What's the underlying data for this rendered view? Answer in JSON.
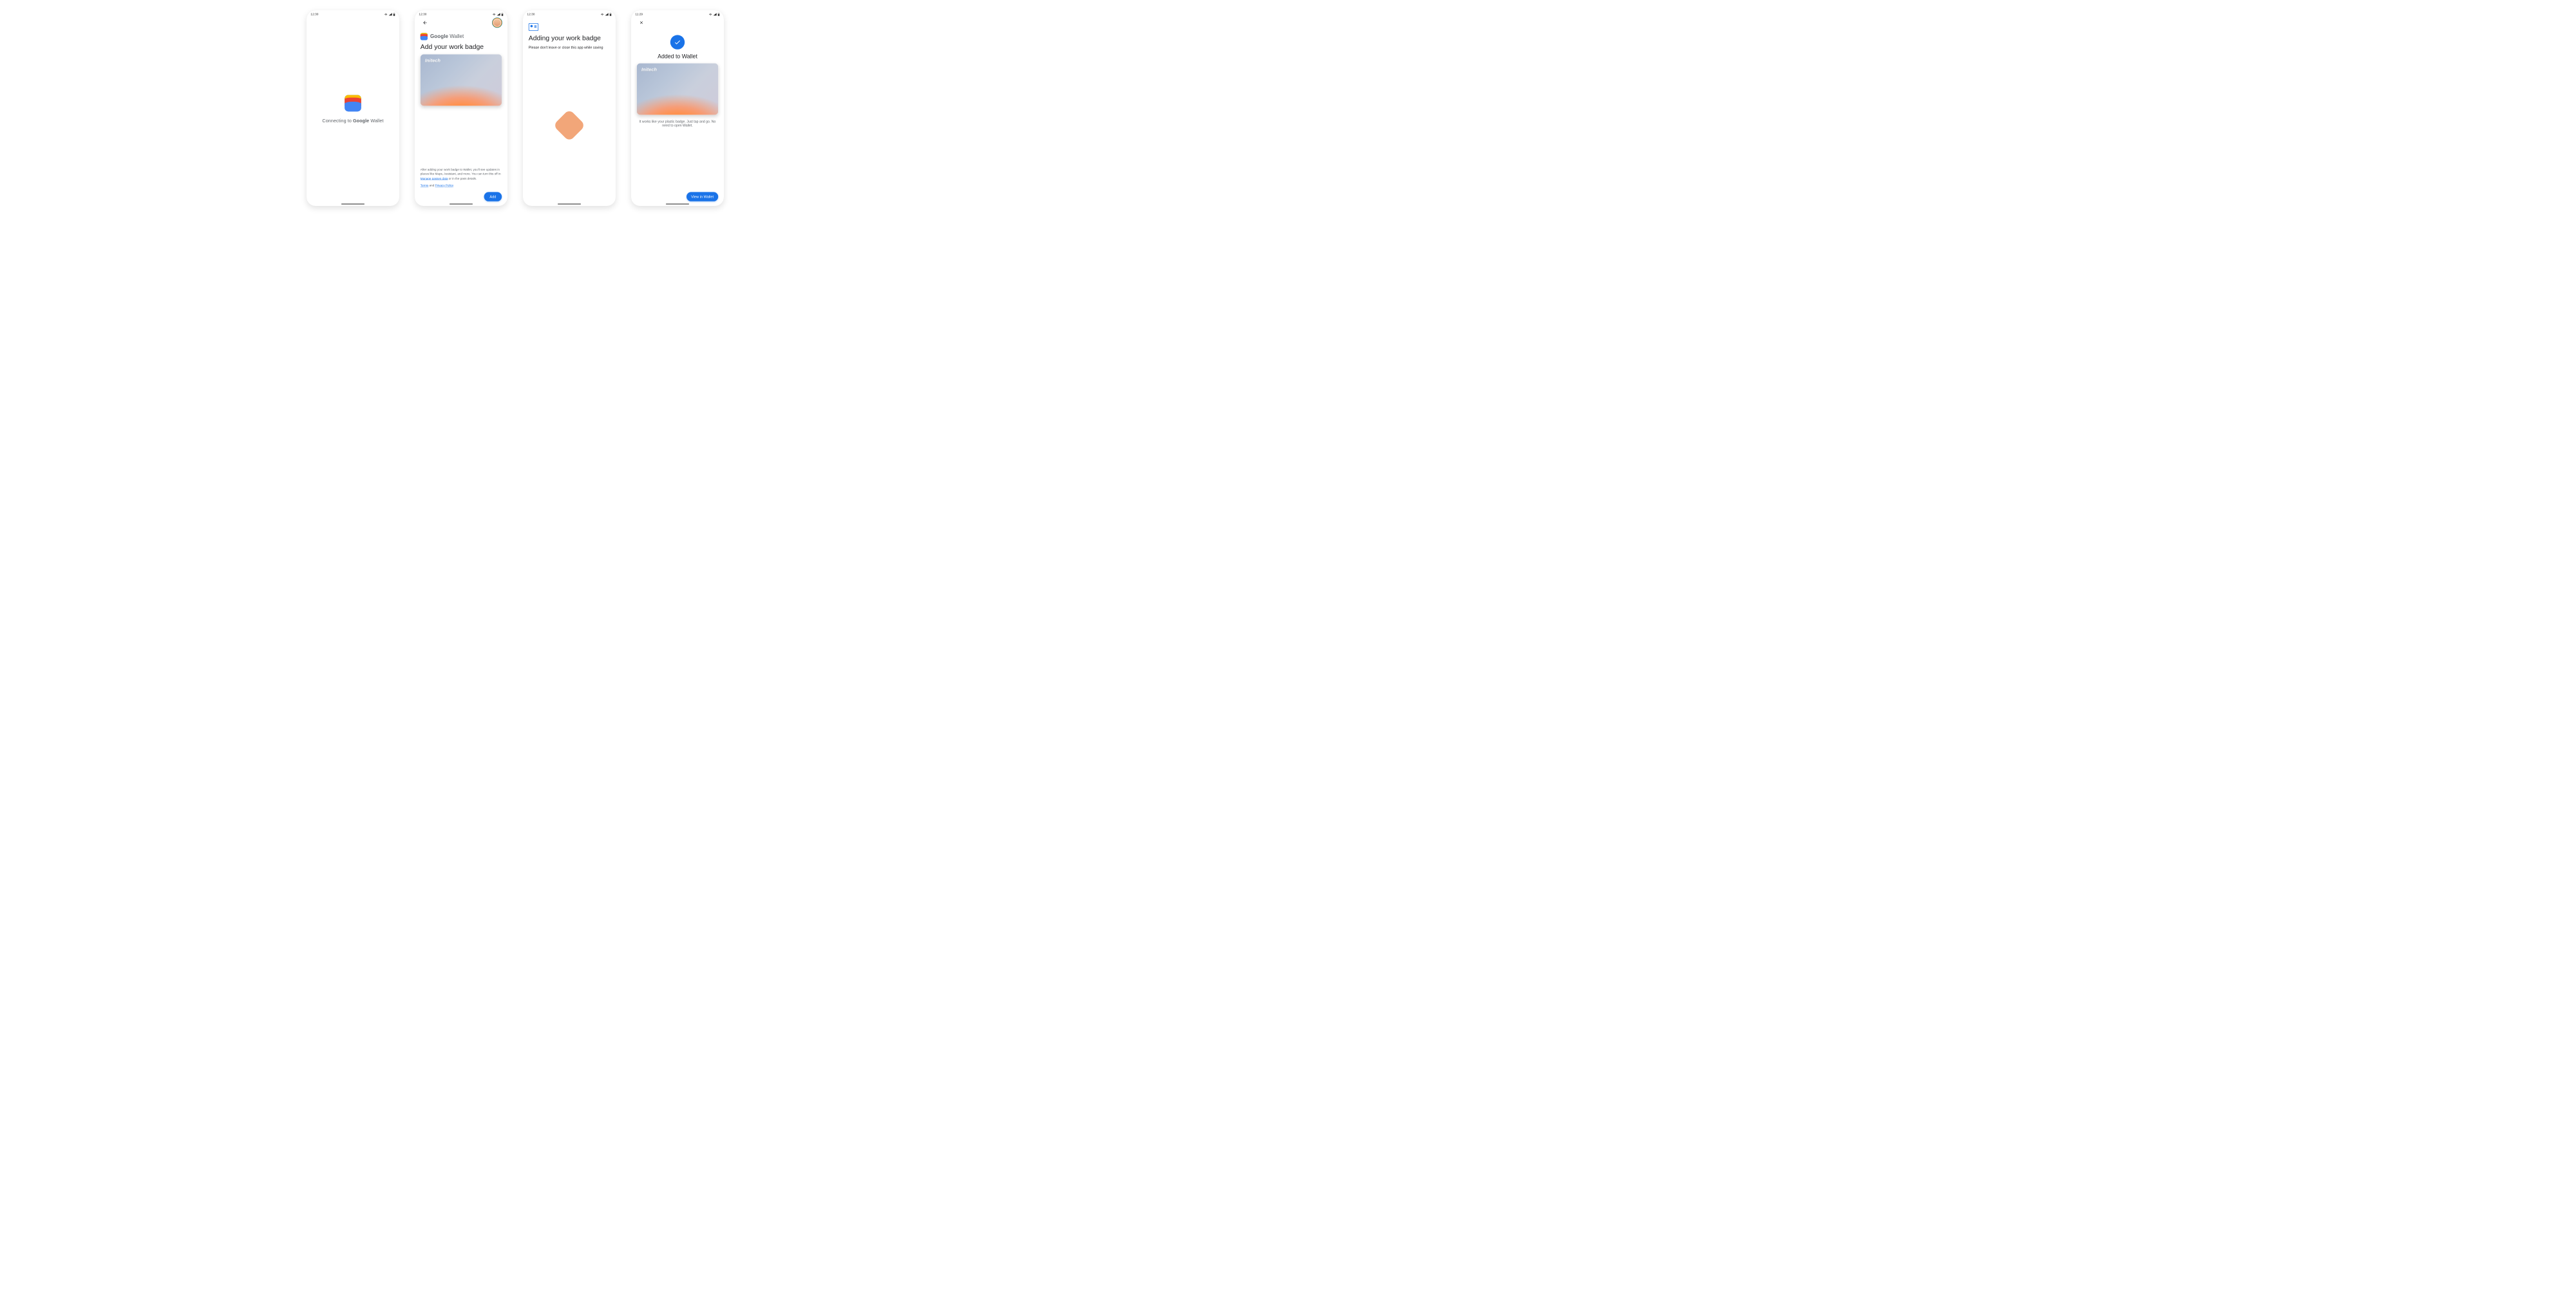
{
  "status": {
    "time_a": "12:30",
    "time_b": "12:30",
    "time_c": "12:30",
    "time_d": "11:29"
  },
  "s1": {
    "connecting_pre": "Connecting to ",
    "google": "Google",
    "wallet": " Wallet"
  },
  "s2": {
    "google": "Google",
    "wallet": " Wallet",
    "title": "Add your work badge",
    "card_brand": "Initech",
    "disclaimer_a": "After adding your work badge to Wallet, you'll see updates in places like Maps, Assistant, and more. You can turn this off in ",
    "manage_link": "Manage passes data",
    "disclaimer_b": " or in the pass details.",
    "terms": "Terms",
    "and": " and ",
    "privacy": "Privacy Policy",
    "add_btn": "Add"
  },
  "s3": {
    "title": "Adding your work badge",
    "subtitle": "Please don't leave or close this app while saving"
  },
  "s4": {
    "title": "Added to Wallet",
    "card_brand": "Initech",
    "desc": "It works like your plastic badge. Just tap and go. No need to open Wallet.",
    "view_btn": "View in Wallet"
  }
}
